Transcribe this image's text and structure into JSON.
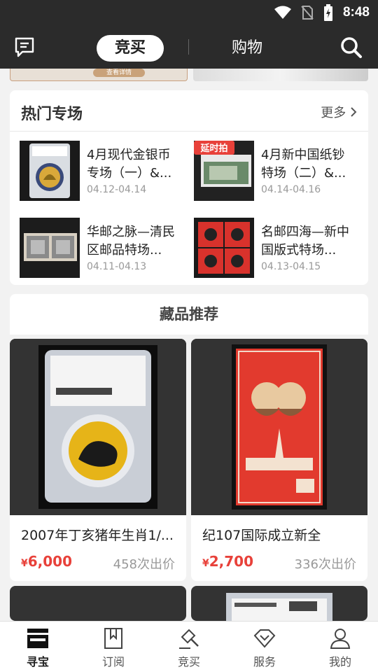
{
  "status": {
    "time": "8:48"
  },
  "topbar": {
    "active_tab": "竞买",
    "tab": "购物"
  },
  "banner": {
    "cta": "查看详情"
  },
  "hot": {
    "title": "热门专场",
    "more": "更多",
    "items": [
      {
        "name": "4月现代金银币专场（一）&...",
        "date": "04.12-04.14"
      },
      {
        "name": "4月新中国纸钞特场（二）&...",
        "date": "04.14-04.16",
        "badge": "延时拍"
      },
      {
        "name": "华邮之脉—清民区邮品特场...",
        "date": "04.11-04.13"
      },
      {
        "name": "名邮四海—新中国版式特场...",
        "date": "04.13-04.15"
      }
    ]
  },
  "recommend": {
    "title": "藏品推荐",
    "cards": [
      {
        "title": "2007年丁亥猪年生肖1/...",
        "currency": "¥",
        "price": "6,000",
        "bids": "458次出价"
      },
      {
        "title": "纪107国际成立新全",
        "currency": "¥",
        "price": "2,700",
        "bids": "336次出价"
      }
    ]
  },
  "tabbar": {
    "items": [
      "寻宝",
      "订阅",
      "竞买",
      "服务",
      "我的"
    ]
  },
  "colors": {
    "dark": "#2b2b2b",
    "price": "#e8413a"
  },
  "icons": [
    "wifi-icon",
    "no-sim-icon",
    "battery-icon",
    "message-icon",
    "search-icon",
    "chevron-right-icon",
    "treasure-icon",
    "subscribe-icon",
    "auction-gavel-icon",
    "service-icon",
    "profile-icon"
  ]
}
